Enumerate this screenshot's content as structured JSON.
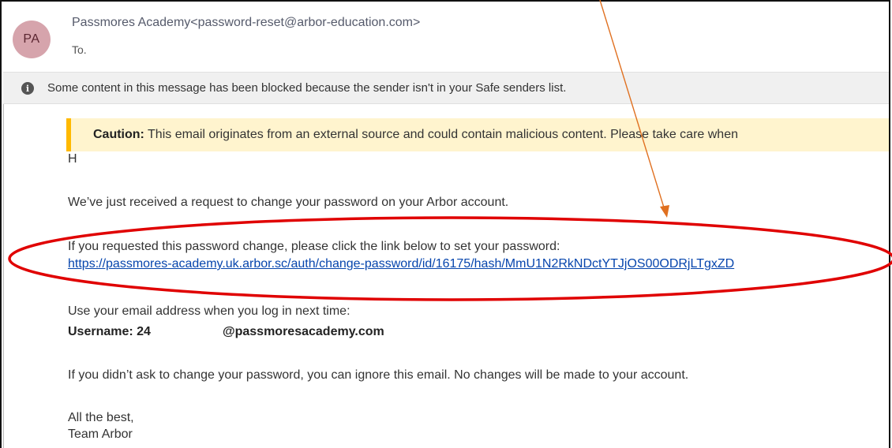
{
  "header": {
    "avatar_initials": "PA",
    "sender": "Passmores Academy<password-reset@arbor-education.com>",
    "to_label": "To."
  },
  "banner": {
    "icon": "info-icon",
    "text": "Some content in this message has been blocked because the sender isn't in your Safe senders list."
  },
  "caution": {
    "label": "Caution:",
    "text": " This email originates from an external source and could contain malicious content. Please take care when"
  },
  "email": {
    "greeting": "H",
    "line1": "We’ve just received a request to change your password on your Arbor account.",
    "line2": "If you requested this password change, please click the link below to set your password:",
    "link": "https://passmores-academy.uk.arbor.sc/auth/change-password/id/16175/hash/MmU1N2RkNDctYTJjOS00ODRjLTgxZD",
    "line3": "Use your email address when you log in next time:",
    "username_label": "Username: 24",
    "username_domain": "@passmoresacademy.com",
    "line4": "If you didn’t ask to change your password, you can ignore this email. No changes will be made to your account.",
    "signoff": "All the best,",
    "signature": "Team Arbor"
  },
  "colors": {
    "avatar_bg": "#d6a4ac",
    "caution_bar": "#ffb900",
    "caution_bg": "#fff4ce",
    "link": "#0645ad",
    "annotation_red": "#e00000",
    "annotation_arrow": "#e07020"
  }
}
